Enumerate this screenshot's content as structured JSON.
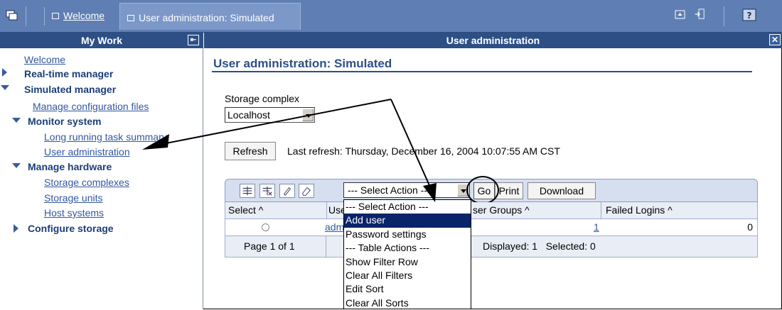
{
  "top_tabs": {
    "welcome": "Welcome",
    "active": "User administration: Simulated"
  },
  "left_panel": {
    "header": "My Work",
    "items": [
      {
        "label": "Welcome"
      },
      {
        "label": "Real-time manager"
      },
      {
        "label": "Simulated manager"
      },
      {
        "label": "Manage configuration files"
      },
      {
        "label": "Monitor system"
      },
      {
        "label": "Long running task summary"
      },
      {
        "label": "User administration"
      },
      {
        "label": "Manage hardware"
      },
      {
        "label": "Storage complexes"
      },
      {
        "label": "Storage units"
      },
      {
        "label": "Host systems"
      },
      {
        "label": "Configure storage"
      }
    ]
  },
  "right_panel": {
    "header": "User administration",
    "page_title": "User administration: Simulated",
    "storage_label": "Storage complex",
    "storage_value": "Localhost",
    "refresh_label": "Refresh",
    "last_refresh": "Last refresh: Thursday, December 16, 2004 10:07:55 AM CST"
  },
  "table": {
    "action_select": "--- Select Action ---",
    "go": "Go",
    "print": "Print",
    "download": "Download",
    "columns": [
      "Select ^",
      "Use",
      "ser Groups ^",
      "Failed Logins ^"
    ],
    "row": {
      "user": "adm",
      "groups": "1",
      "failed": "0"
    },
    "footer": {
      "page": "Page 1 of 1",
      "status": "Displayed: 1   Selected: 0"
    }
  },
  "dropdown_options": [
    "--- Select Action ---",
    "Add user",
    "Password settings",
    "--- Table Actions ---",
    "Show Filter Row",
    "Clear All Filters",
    "Edit Sort",
    "Clear All Sorts"
  ],
  "colors": {
    "header_blue": "#2d4f86",
    "topbar_blue": "#5f7fb4",
    "link_blue": "#3357a0",
    "selection": "#0a246a"
  }
}
